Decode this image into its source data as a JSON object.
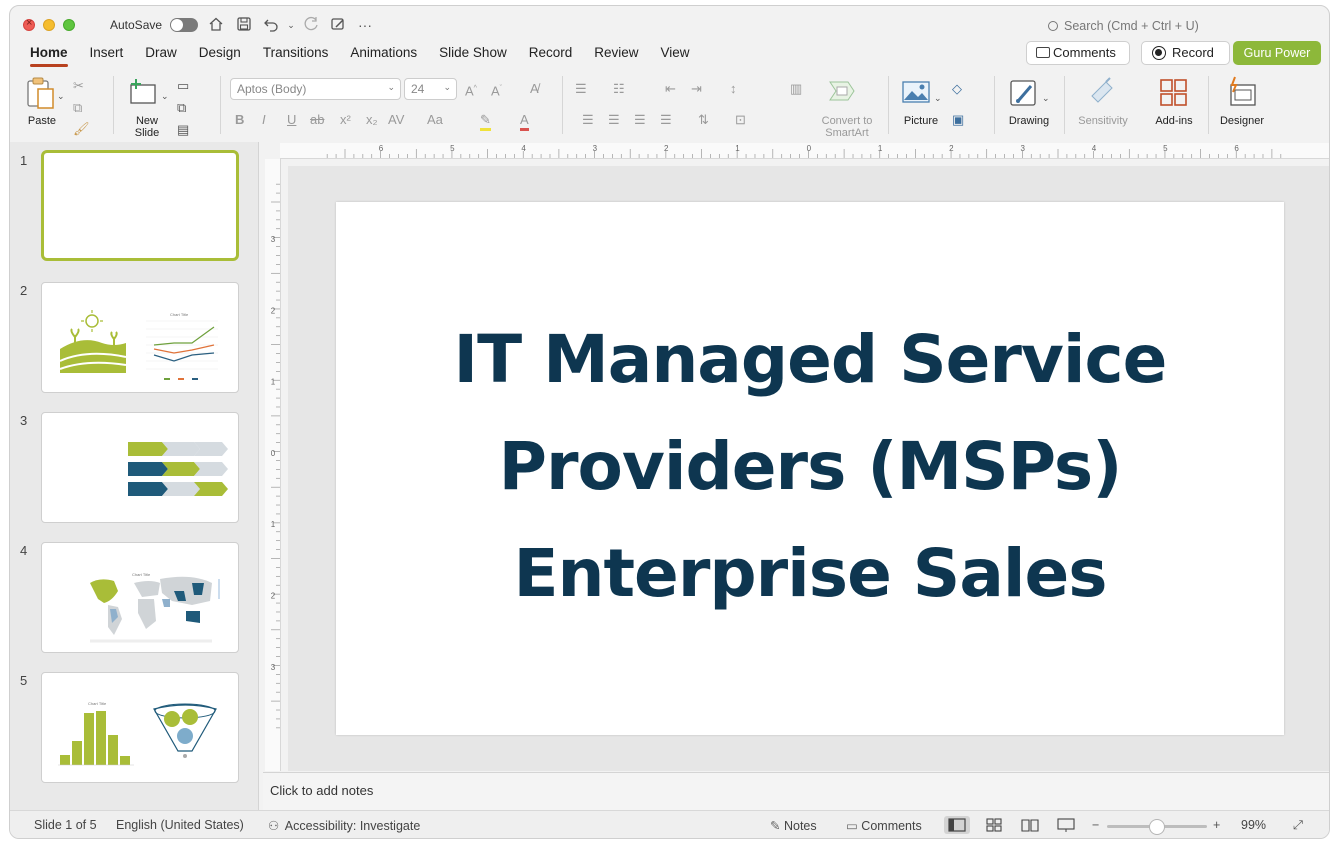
{
  "window": {
    "autosave_label": "AutoSave",
    "search_placeholder": "Search (Cmd + Ctrl + U)"
  },
  "tabs": [
    "Home",
    "Insert",
    "Draw",
    "Design",
    "Transitions",
    "Animations",
    "Slide Show",
    "Record",
    "Review",
    "View"
  ],
  "active_tab": "Home",
  "header_buttons": {
    "comments": "Comments",
    "record": "Record",
    "guru": "Guru Power"
  },
  "ribbon": {
    "paste": "Paste",
    "new_slide_line1": "New",
    "new_slide_line2": "Slide",
    "font_name": "Aptos (Body)",
    "font_size": "24",
    "convert_line1": "Convert to",
    "convert_line2": "SmartArt",
    "picture": "Picture",
    "drawing": "Drawing",
    "sensitivity": "Sensitivity",
    "addins": "Add-ins",
    "designer": "Designer"
  },
  "slides_panel": {
    "numbers": [
      "1",
      "2",
      "3",
      "4",
      "5"
    ],
    "selected": 1,
    "thumb2_chart_title": "Chart Title",
    "thumb4_chart_title": "Chart Title",
    "thumb5_chart_title": "Chart Title"
  },
  "ruler": {
    "h_labels": [
      "6",
      "5",
      "4",
      "3",
      "2",
      "1",
      "0",
      "1",
      "2",
      "3",
      "4",
      "5",
      "6"
    ],
    "v_labels": [
      "3",
      "2",
      "1",
      "0",
      "1",
      "2",
      "3"
    ]
  },
  "slide": {
    "title_lines": [
      "IT Managed Service",
      "Providers (MSPs)",
      "Enterprise Sales"
    ],
    "title_color": "#0e3650"
  },
  "notes_placeholder": "Click to add notes",
  "status": {
    "slide_info": "Slide 1 of 5",
    "language": "English (United States)",
    "accessibility": "Accessibility: Investigate",
    "notes": "Notes",
    "comments": "Comments",
    "zoom": "99%",
    "zoom_level": 0.5
  },
  "colors": {
    "accent_green": "#a9bd38",
    "guru_button": "#8db83a",
    "tab_underline": "#b8411f",
    "navy": "#1f5a7a"
  }
}
